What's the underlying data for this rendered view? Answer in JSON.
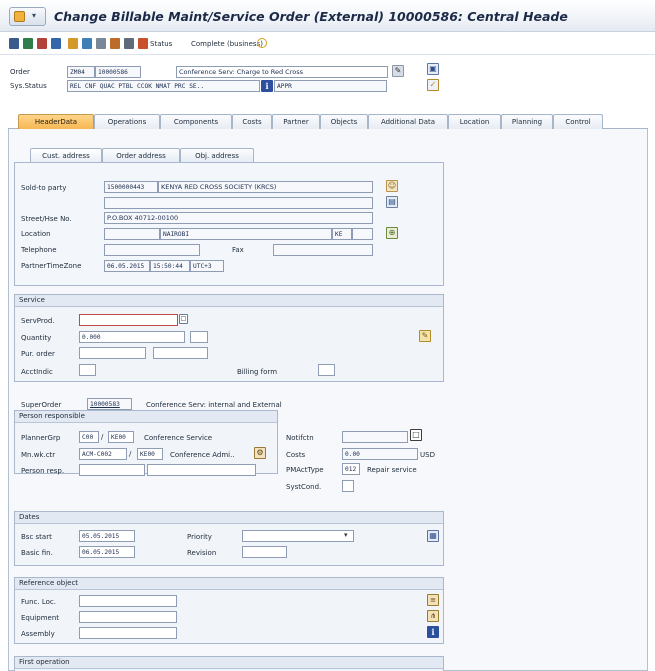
{
  "window": {
    "title": "Change Billable Maint/Service Order (External) 10000586: Central Heade"
  },
  "toolbar": {
    "status_label": "Status",
    "complete_label": "Complete (business)"
  },
  "header": {
    "order_label": "Order",
    "order_type": "ZM04",
    "order_number": "10000586",
    "order_description": "Conference Serv: Charge to Red Cross",
    "sysstatus_label": "Sys.Status",
    "sysstatus_value": "REL  CNF  QUAC PTBL CCOK NMAT PRC  SE..",
    "user_status_value": "APPR"
  },
  "tabs": [
    {
      "label": "HeaderData"
    },
    {
      "label": "Operations"
    },
    {
      "label": "Components"
    },
    {
      "label": "Costs"
    },
    {
      "label": "Partner"
    },
    {
      "label": "Objects"
    },
    {
      "label": "Additional Data"
    },
    {
      "label": "Location"
    },
    {
      "label": "Planning"
    },
    {
      "label": "Control"
    }
  ],
  "subtabs": [
    {
      "label": "Cust. address"
    },
    {
      "label": "Order address"
    },
    {
      "label": "Obj. address"
    }
  ],
  "address": {
    "sold_to_label": "Sold-to party",
    "sold_to_number": "1500000443",
    "sold_to_name": "KENYA RED CROSS SOCIETY (KRCS)",
    "street_label": "Street/Hse No.",
    "street_value": "P.O.BOX 40712-00100",
    "location_label": "Location",
    "location_city": "NAIROBI",
    "location_country": "KE",
    "telephone_label": "Telephone",
    "fax_label": "Fax",
    "timezone_label": "PartnerTimeZone",
    "tz_date": "06.05.2015",
    "tz_time": "15:50:44",
    "tz_zone": "UTC+3"
  },
  "service": {
    "title": "Service",
    "servprod_label": "ServProd.",
    "quantity_label": "Quantity",
    "quantity_value": "0.000",
    "purorder_label": "Pur. order",
    "acctindic_label": "AcctIndic",
    "billing_label": "Billing form"
  },
  "superorder": {
    "label": "SuperOrder",
    "number": "10000583",
    "description": "Conference Serv: internal and External"
  },
  "person": {
    "title": "Person responsible",
    "planner_label": "PlannerGrp",
    "planner_code": "C00",
    "planner_plant": "KE00",
    "planner_desc": "Conference Service",
    "workctr_label": "Mn.wk.ctr",
    "workctr_code": "ACM-C002",
    "workctr_plant": "KE00",
    "workctr_desc": "Conference Admi..",
    "personresp_label": "Person resp.",
    "notif_label": "Notifctn",
    "costs_label": "Costs",
    "costs_value": "0.00",
    "costs_currency": "USD",
    "pmact_label": "PMActType",
    "pmact_code": "012",
    "pmact_desc": "Repair service",
    "systcond_label": "SystCond."
  },
  "dates": {
    "title": "Dates",
    "bsc_start_label": "Bsc start",
    "bsc_start_value": "05.05.2015",
    "basic_fin_label": "Basic fin.",
    "basic_fin_value": "06.05.2015",
    "priority_label": "Priority",
    "revision_label": "Revision"
  },
  "reference": {
    "title": "Reference object",
    "funcloc_label": "Func. Loc.",
    "equipment_label": "Equipment",
    "assembly_label": "Assembly"
  },
  "first_operation": {
    "title": "First operation"
  },
  "colors": {
    "active_tab": "#f6b652",
    "group_bg": "#f1f4f9",
    "title_text": "#1c2a48"
  }
}
